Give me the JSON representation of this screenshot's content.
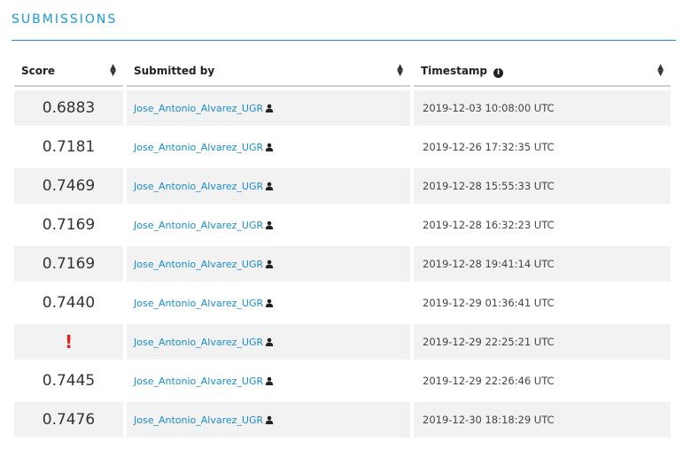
{
  "section": {
    "title": "SUBMISSIONS"
  },
  "colors": {
    "accent": "#1a9ad6",
    "link": "#1a8ccf",
    "error": "#e2231a",
    "stripe": "#f2f2f2"
  },
  "table": {
    "columns": [
      {
        "label": "Score",
        "sortable": true
      },
      {
        "label": "Submitted by",
        "sortable": true
      },
      {
        "label": "Timestamp",
        "sortable": true,
        "icon": "info-icon"
      }
    ],
    "rows": [
      {
        "score": "0.6883",
        "user": "Jose_Antonio_Alvarez_UGR",
        "timestamp": "2019-12-03 10:08:00 UTC"
      },
      {
        "score": "0.7181",
        "user": "Jose_Antonio_Alvarez_UGR",
        "timestamp": "2019-12-26 17:32:35 UTC"
      },
      {
        "score": "0.7469",
        "user": "Jose_Antonio_Alvarez_UGR",
        "timestamp": "2019-12-28 15:55:33 UTC"
      },
      {
        "score": "0.7169",
        "user": "Jose_Antonio_Alvarez_UGR",
        "timestamp": "2019-12-28 16:32:23 UTC"
      },
      {
        "score": "0.7169",
        "user": "Jose_Antonio_Alvarez_UGR",
        "timestamp": "2019-12-28 19:41:14 UTC"
      },
      {
        "score": "0.7440",
        "user": "Jose_Antonio_Alvarez_UGR",
        "timestamp": "2019-12-29 01:36:41 UTC"
      },
      {
        "score": "!",
        "error": true,
        "user": "Jose_Antonio_Alvarez_UGR",
        "timestamp": "2019-12-29 22:25:21 UTC"
      },
      {
        "score": "0.7445",
        "user": "Jose_Antonio_Alvarez_UGR",
        "timestamp": "2019-12-29 22:26:46 UTC"
      },
      {
        "score": "0.7476",
        "user": "Jose_Antonio_Alvarez_UGR",
        "timestamp": "2019-12-30 18:18:29 UTC"
      }
    ]
  }
}
